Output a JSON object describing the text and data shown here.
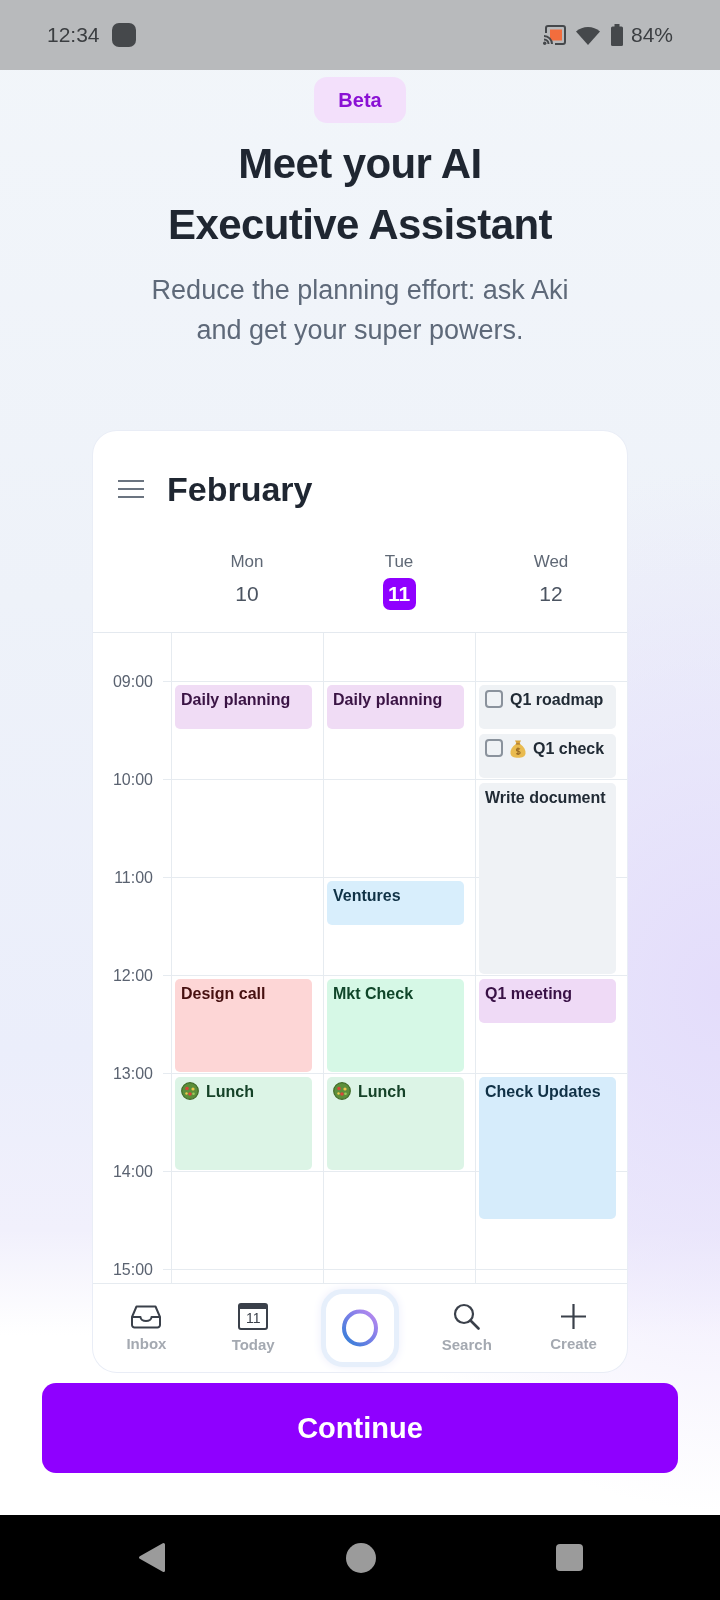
{
  "status_bar": {
    "time": "12:34",
    "battery": "84%"
  },
  "badge": "Beta",
  "headline": "Meet your AI Executive Assistant",
  "subtitle": "Reduce the planning effort: ask Aki and get your super powers.",
  "calendar": {
    "month": "February",
    "hours": [
      "09:00",
      "10:00",
      "11:00",
      "12:00",
      "13:00",
      "14:00",
      "15:00"
    ],
    "days": [
      {
        "name": "Mon",
        "date": "10",
        "today": false,
        "slots": [
          {
            "kind": "event",
            "title": "Daily planning",
            "color": "#f0dcf5"
          },
          {
            "kind": "free"
          },
          {
            "kind": "free"
          },
          {
            "kind": "free"
          },
          {
            "kind": "free"
          },
          {
            "kind": "free"
          },
          {
            "kind": "event",
            "title": "Design call",
            "color": "#fdd6d6"
          },
          {
            "kind": "continued"
          },
          {
            "kind": "meal",
            "title": "Lunch",
            "color": "#dcf4e6"
          },
          {
            "kind": "continued"
          }
        ]
      },
      {
        "name": "Tue",
        "date": "11",
        "today": true,
        "slots": [
          {
            "kind": "event",
            "title": "Daily planning",
            "color": "#f0dcf5"
          },
          {
            "kind": "free"
          },
          {
            "kind": "free"
          },
          {
            "kind": "free"
          },
          {
            "kind": "event",
            "title": "Ventures",
            "color": "#d8eefc"
          },
          {
            "kind": "free"
          },
          {
            "kind": "event",
            "title": "Mkt Check",
            "color": "#d6f8e6"
          },
          {
            "kind": "continued"
          },
          {
            "kind": "meal",
            "title": "Lunch",
            "color": "#dcf4e6"
          },
          {
            "kind": "continued"
          }
        ]
      },
      {
        "name": "Wed",
        "date": "12",
        "today": false,
        "slots": [
          {
            "kind": "task",
            "title": "Q1 roadmap",
            "checked": false,
            "color": "#eff2f5"
          },
          {
            "kind": "budget",
            "title": "Q1 check",
            "checked": false,
            "color": "#eff2f5"
          },
          {
            "kind": "event",
            "title": "Write document",
            "color": "#eff2f5"
          },
          {
            "kind": "continued"
          },
          {
            "kind": "continued"
          },
          {
            "kind": "continued"
          },
          {
            "kind": "event",
            "title": "Q1 meeting",
            "color": "#efdaf6"
          },
          {
            "kind": "free"
          },
          {
            "kind": "event",
            "title": "Check Updates",
            "color": "#d6ecfb"
          },
          {
            "kind": "continued"
          },
          {
            "kind": "continued"
          }
        ]
      }
    ]
  },
  "tab_bar": [
    {
      "kind": "inbox",
      "label": "Inbox"
    },
    {
      "kind": "today",
      "label": "Today",
      "badge": "11"
    },
    {
      "kind": "assistant"
    },
    {
      "kind": "search",
      "label": "Search"
    },
    {
      "kind": "create",
      "label": "Create"
    }
  ],
  "primary_button": "Continue"
}
